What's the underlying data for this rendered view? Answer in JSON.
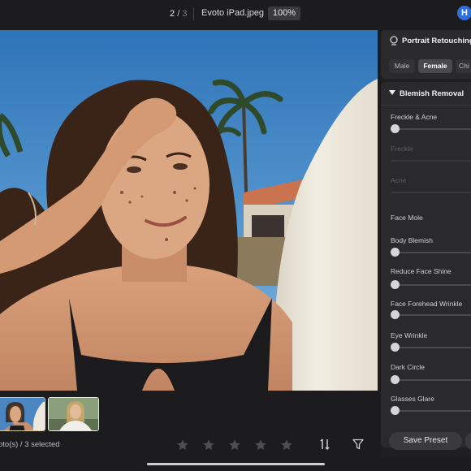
{
  "topbar": {
    "counter_current": "2",
    "counter_sep": "/",
    "counter_total": "3",
    "filename": "Evoto iPad.jpeg",
    "zoom": "100%",
    "avatar_initial": "H"
  },
  "filmstrip": {
    "selection_info": "oto(s) / 3 selected",
    "rating_stars": 5
  },
  "panel": {
    "portrait_retouching": "Portrait Retouching",
    "gender_options": [
      "Male",
      "Female",
      "Chi"
    ],
    "selected_gender": "Female",
    "blemish_title": "Blemish Removal",
    "controls": [
      {
        "label": "Freckle & Acne",
        "slider": true,
        "value": 0,
        "dim": false
      },
      {
        "label": "Freckle",
        "slider": true,
        "value": null,
        "dim": true
      },
      {
        "label": "Acne",
        "slider": true,
        "value": null,
        "dim": true
      },
      {
        "label": "Face Mole",
        "slider": false,
        "value": null,
        "dim": false
      },
      {
        "label": "Body Blemish",
        "slider": true,
        "value": 0,
        "dim": false
      },
      {
        "label": "Reduce Face Shine",
        "slider": true,
        "value": 0,
        "dim": false
      },
      {
        "label": "Face Forehead Wrinkle",
        "slider": true,
        "value": 0,
        "dim": false
      },
      {
        "label": "Eye Wrinkle",
        "slider": true,
        "value": 0,
        "dim": false
      },
      {
        "label": "Dark Circle",
        "slider": true,
        "value": 0,
        "dim": false
      },
      {
        "label": "Glasses Glare",
        "slider": true,
        "value": 0,
        "dim": false
      }
    ],
    "save_preset": "Save Preset"
  },
  "icons": {
    "star": "star-outline",
    "sort": "sort-arrows",
    "filter": "funnel",
    "portrait": "face-retouch"
  },
  "colors": {
    "accent": "#2f6fe0",
    "background": "#1c1c1e",
    "panel": "#2a2a2c"
  }
}
